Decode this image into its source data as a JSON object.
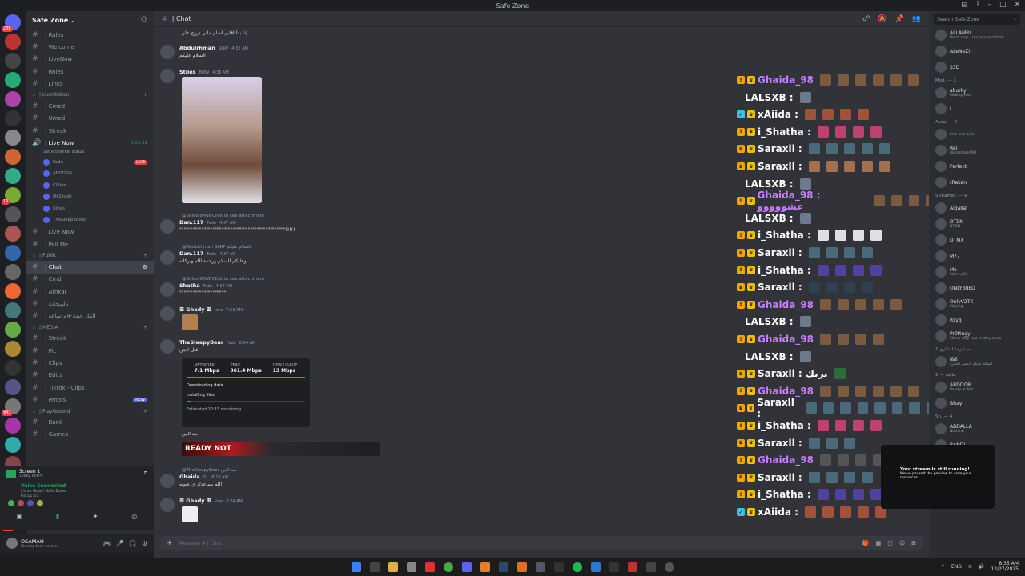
{
  "window": {
    "title": "Safe Zone"
  },
  "server": {
    "name": "Safe Zone"
  },
  "channels": {
    "top": [
      {
        "label": "| Rules"
      },
      {
        "label": "| Welcome"
      },
      {
        "label": "| LiveNow"
      },
      {
        "label": "| Roles"
      },
      {
        "label": "| Links"
      }
    ],
    "livestation_cat": "| LiveStation",
    "livestation": [
      {
        "label": "| Cmod"
      },
      {
        "label": "| Umod"
      },
      {
        "label": "| Streak"
      }
    ],
    "live_now": {
      "label": "| Live Now",
      "timer": "0:53:31",
      "status": "Set a channel status",
      "live_tag": "LIVE"
    },
    "voice_users": [
      "Fade",
      "ABDDGR",
      "Cliilan",
      "McCrash",
      "Stiles",
      "TheSleepyBear"
    ],
    "after_voice": [
      {
        "label": "| Live Now"
      },
      {
        "label": "| Poll Me"
      }
    ],
    "public_cat": "| Public",
    "public": [
      {
        "label": "| Chat",
        "active": true
      },
      {
        "label": "| Cmd"
      },
      {
        "label": "| Athkar"
      },
      {
        "label": "| تالويحات"
      },
      {
        "label": "| الكل حيث-24-ساعه"
      }
    ],
    "media_cat": "| MEDIA",
    "media": [
      {
        "label": "| Streak"
      },
      {
        "label": "| Pic"
      },
      {
        "label": "| Clips"
      },
      {
        "label": "| Edits"
      },
      {
        "label": "| Tiktok - Clips"
      },
      {
        "label": "| emots",
        "tag": "NEW"
      }
    ],
    "playground_cat": "| PlayGround",
    "playground": [
      {
        "label": "| Bank"
      },
      {
        "label": "| Games"
      }
    ]
  },
  "voice_panel": {
    "screen": "Screen 1",
    "screen_sub": "1080p 60FPS",
    "connected": "Voice Connected",
    "channel": "| Live Now / Safe Zone",
    "time": "05:11:51"
  },
  "user_panel": {
    "name": "OSAMAH",
    "status": "Sharing their screen"
  },
  "header": {
    "channel": "| Chat"
  },
  "messages": [
    {
      "author": "",
      "text": "إذا بدأ اقليم اسلم مابي تروح علي"
    },
    {
      "author": "Abdulrhman",
      "tag": "SLRP",
      "time": "4:32 AM",
      "text": "السلام عليكم"
    },
    {
      "author": "Stiles",
      "tag": "BMW",
      "time": "4:36 AM",
      "text": ""
    },
    {
      "reply": "@Stiles BMW Click to see attachment",
      "author": "Dan.117",
      "tag": "Fade",
      "time": "4:37 AM",
      "text": "\"\"\"\"\"\"\"\"\"\"\"\"\"\"\"\"\"\"\"\"\"\"\"\"\"\"\"\"\"\"\"\"\"\"\"\"\"\"\"\"\"\"\"\"\"\"\"\"!!!!!"
    },
    {
      "reply": "@Abdulrhman SLRP السلام عليكم",
      "author": "Dan.117",
      "tag": "Fade",
      "time": "4:37 AM",
      "text": "وعليكم السلام ورحمة الله وبركاته"
    },
    {
      "reply": "@Stiles BMW Click to see attachment",
      "author": "Shatha",
      "tag": "Fade",
      "time": "4:37 AM",
      "text": "\"\"\"\"\"\"\"\"\"\"\"\"\"\"\"\"\"\"\"\"\""
    },
    {
      "author": "ꕥ Ghady ꕥ",
      "tag": "love",
      "time": "7:53 AM",
      "text": ""
    },
    {
      "author": "TheSleepyBear",
      "tag": "Fade",
      "time": "8:04 AM",
      "text": "قبل الجن"
    },
    {
      "reply": "@TheSleepyBear بعد الجن",
      "author": "Ghaida",
      "tag": "OL",
      "time": "8:18 AM",
      "text": "الله يساعدك ي عيونه"
    },
    {
      "author": "ꕥ Ghady ꕥ",
      "tag": "love",
      "time": "8:24 AM",
      "text": ""
    }
  ],
  "download_card": {
    "network_label": "NETWORK",
    "network": "7.1 Mbps",
    "peak_label": "PEAK",
    "peak": "361.4 Mbps",
    "disk_label": "DISK USAGE",
    "disk": "13 Mbps",
    "step1": "Downloading data",
    "step2": "Installing files",
    "eta": "Estimated 12:15 remaining",
    "progress": 1.0
  },
  "after_card_text": "بعد الجن",
  "banner_text": "READY NOT",
  "composer": {
    "placeholder": "Message # | Chat"
  },
  "overlay_rows": [
    {
      "name": "Ghaida_98",
      "color": "#c77dff",
      "badge": "!",
      "badge_color": "#f0a500",
      "emote_color": "#7a5a40",
      "n": 6
    },
    {
      "name": "LALSXB :",
      "color": "#ffffff",
      "badge": "",
      "emote_color": "#6b7b8c",
      "n": 1
    },
    {
      "name": "xAiida :",
      "color": "#ffffff",
      "badge": "✓",
      "badge_color": "#40c0e0",
      "emote_color": "#a0523a",
      "n": 4
    },
    {
      "name": "i_Shatha :",
      "color": "#ffffff",
      "badge": "!",
      "badge_color": "#f0a500",
      "emote_color": "#c04070",
      "n": 4
    },
    {
      "name": "Saraxll :",
      "color": "#ffffff",
      "badge": "♛",
      "badge_color": "#f0a500",
      "emote_color": "#4a6a7a",
      "n": 5
    },
    {
      "name": "Saraxll :",
      "color": "#ffffff",
      "badge": "♛",
      "badge_color": "#f0a500",
      "emote_color": "#a07050",
      "n": 5
    },
    {
      "name": "LALSXB :",
      "color": "#ffffff",
      "badge": "",
      "emote_color": "#6b7b8c",
      "n": 1
    },
    {
      "name": "Ghaida_98 : عشووووو",
      "color": "#c77dff",
      "badge": "!",
      "badge_color": "#f0a500",
      "emote_color": "#7a5a40",
      "n": 4
    },
    {
      "name": "LALSXB :",
      "color": "#ffffff",
      "badge": "",
      "emote_color": "#6b7b8c",
      "n": 1
    },
    {
      "name": "i_Shatha :",
      "color": "#ffffff",
      "badge": "!",
      "badge_color": "#f0a500",
      "emote_color": "#e0e0e0",
      "n": 4
    },
    {
      "name": "Saraxll :",
      "color": "#ffffff",
      "badge": "♛",
      "badge_color": "#f0a500",
      "emote_color": "#4a6a7a",
      "n": 4
    },
    {
      "name": "i_Shatha :",
      "color": "#ffffff",
      "badge": "!",
      "badge_color": "#f0a500",
      "emote_color": "#5040a0",
      "n": 4
    },
    {
      "name": "Saraxll :",
      "color": "#ffffff",
      "badge": "♛",
      "badge_color": "#f0a500",
      "emote_color": "#304050",
      "n": 4
    },
    {
      "name": "Ghaida_98",
      "color": "#c77dff",
      "badge": "!",
      "badge_color": "#f0a500",
      "emote_color": "#7a5a40",
      "n": 5
    },
    {
      "name": "LALSXB :",
      "color": "#ffffff",
      "badge": "",
      "emote_color": "#6b7b8c",
      "n": 1
    },
    {
      "name": "Ghaida_98",
      "color": "#c77dff",
      "badge": "!",
      "badge_color": "#f0a500",
      "emote_color": "#7a5a40",
      "n": 4
    },
    {
      "name": "LALSXB :",
      "color": "#ffffff",
      "badge": "",
      "emote_color": "#6b7b8c",
      "n": 1
    },
    {
      "name": "Saraxll : بريك",
      "color": "#ffffff",
      "badge": "♛",
      "badge_color": "#f0a500",
      "emote_color": "#2f6a3a",
      "n": 1
    },
    {
      "name": "Ghaida_98",
      "color": "#c77dff",
      "badge": "!",
      "badge_color": "#f0a500",
      "emote_color": "#7a5a40",
      "n": 6
    },
    {
      "name": "Saraxll :",
      "color": "#ffffff",
      "badge": "♛",
      "badge_color": "#f0a500",
      "emote_color": "#4a6a7a",
      "n": 8
    },
    {
      "name": "i_Shatha :",
      "color": "#ffffff",
      "badge": "!",
      "badge_color": "#f0a500",
      "emote_color": "#c04070",
      "n": 4
    },
    {
      "name": "Saraxll :",
      "color": "#ffffff",
      "badge": "♛",
      "badge_color": "#f0a500",
      "emote_color": "#4a6a7a",
      "n": 3
    },
    {
      "name": "Ghaida_98",
      "color": "#c77dff",
      "badge": "!",
      "badge_color": "#f0a500",
      "emote_color": "#555",
      "n": 5
    },
    {
      "name": "Saraxll :",
      "color": "#ffffff",
      "badge": "♛",
      "badge_color": "#f0a500",
      "emote_color": "#4a6a7a",
      "n": 4
    },
    {
      "name": "i_Shatha :",
      "color": "#ffffff",
      "badge": "!",
      "badge_color": "#f0a500",
      "emote_color": "#5040a0",
      "n": 4
    },
    {
      "name": "xAiida :",
      "color": "#ffffff",
      "badge": "✓",
      "badge_color": "#40c0e0",
      "emote_color": "#a0523a",
      "n": 5
    }
  ],
  "members": {
    "search_placeholder": "Search Safe Zone",
    "top": [
      {
        "name": "ALLAMRI",
        "status": "Don't stop.. success isn't that..."
      },
      {
        "name": "ALeNeZi",
        "status": ""
      },
      {
        "name": "S3D",
        "status": ""
      }
    ],
    "mod_header": "Mod. — 2",
    "mods": [
      {
        "name": "aburky",
        "status": "Making Fum"
      },
      {
        "name": "L",
        "status": ""
      }
    ],
    "aura_header": "Aura. — 4",
    "aura": [
      {
        "name": "",
        "status": "Live kick.s/3s"
      },
      {
        "name": "Rel",
        "status": "discord.gg/MiU"
      },
      {
        "name": "Perfect",
        "status": ""
      },
      {
        "name": "rRakan",
        "status": ""
      }
    ],
    "streamer_header": "Streamer. — 9",
    "streamers": [
      {
        "name": "Alqallaf",
        "status": ""
      },
      {
        "name": "DTDN",
        "status": "DTDN"
      },
      {
        "name": "DTMX",
        "status": ""
      },
      {
        "name": "M77",
        "status": ""
      },
      {
        "name": "Mo",
        "status": "kick: vs23"
      },
      {
        "name": "ONLY3BED",
        "status": ""
      },
      {
        "name": "OnlyV2TK",
        "status": "Playing"
      },
      {
        "name": "Rsyq",
        "status": ""
      },
      {
        "name": "Pr0ttngy",
        "status": "Either stay real or stay away"
      }
    ],
    "sec_header": "شرحة الشاري 1 —",
    "sec": [
      {
        "name": "l&li",
        "status": "السلام عليكم لاتنسى الجائزة"
      }
    ],
    "header2": "مالجه — 2",
    "list2": [
      {
        "name": "ABDDGR",
        "status": "Ready or Not"
      },
      {
        "name": "BRay",
        "status": ""
      }
    ],
    "header3": "Sh. — 4",
    "list3": [
      {
        "name": "ABDALLA",
        "status": "Nothing"
      },
      {
        "name": "BANDI",
        "status": ""
      }
    ]
  },
  "toast": {
    "title": "Your stream is still running!",
    "text": "We've paused the preview to save your resources."
  },
  "taskbar": {
    "lang": "ENG",
    "time": "8:33 AM",
    "date": "12/27/2025"
  },
  "server_badges": [
    "236",
    "",
    "",
    "",
    "",
    "",
    "",
    "",
    "",
    "19",
    "",
    "",
    "",
    "",
    "",
    "",
    "",
    "",
    "",
    "",
    "943",
    "",
    "",
    "",
    "",
    "",
    "NEW"
  ]
}
